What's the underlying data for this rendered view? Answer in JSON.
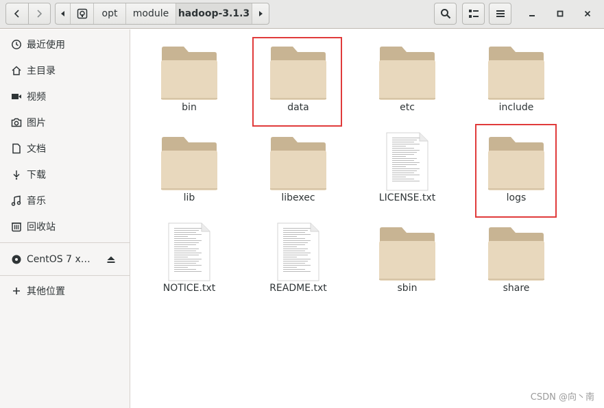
{
  "header": {
    "path": [
      "opt",
      "module",
      "hadoop-3.1.3"
    ]
  },
  "sidebar": {
    "items": [
      {
        "label": "最近使用",
        "icon": "clock-icon"
      },
      {
        "label": "主目录",
        "icon": "home-icon"
      },
      {
        "label": "视频",
        "icon": "video-icon"
      },
      {
        "label": "图片",
        "icon": "camera-icon"
      },
      {
        "label": "文档",
        "icon": "document-icon"
      },
      {
        "label": "下载",
        "icon": "download-icon"
      },
      {
        "label": "音乐",
        "icon": "music-icon"
      },
      {
        "label": "回收站",
        "icon": "trash-icon"
      }
    ],
    "devices": [
      {
        "label": "CentOS 7 x…",
        "icon": "disc-icon"
      }
    ],
    "other": {
      "label": "其他位置",
      "icon": "plus-icon"
    }
  },
  "files": [
    {
      "name": "bin",
      "type": "folder"
    },
    {
      "name": "data",
      "type": "folder",
      "highlighted": true
    },
    {
      "name": "etc",
      "type": "folder"
    },
    {
      "name": "include",
      "type": "folder"
    },
    {
      "name": "lib",
      "type": "folder"
    },
    {
      "name": "libexec",
      "type": "folder"
    },
    {
      "name": "LICENSE.txt",
      "type": "text"
    },
    {
      "name": "logs",
      "type": "folder",
      "highlighted": true
    },
    {
      "name": "NOTICE.txt",
      "type": "text"
    },
    {
      "name": "README.txt",
      "type": "text"
    },
    {
      "name": "sbin",
      "type": "folder"
    },
    {
      "name": "share",
      "type": "folder"
    }
  ],
  "watermark": "CSDN @向丶南",
  "colors": {
    "folder_back": "#c8b493",
    "folder_front": "#e8d8bd",
    "highlight": "#e03a3a"
  }
}
